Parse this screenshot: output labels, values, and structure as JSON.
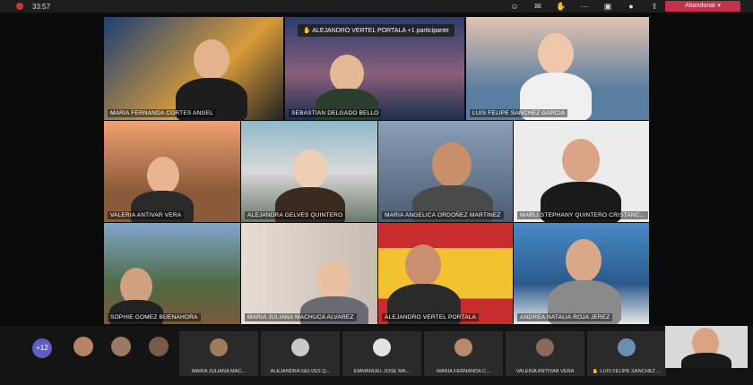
{
  "topbar": {
    "timer": "33:57",
    "leave_label": "Abandonar",
    "icons": [
      "participants-icon",
      "chat-icon",
      "raise-hand-icon",
      "more-icon",
      "camera-icon",
      "microphone-icon",
      "share-icon"
    ]
  },
  "spotlight_tag": "✋ ALEJANDRO VERTEL PORTALA +1 participante",
  "tiles": [
    {
      "name": "MARIA FERNANDA CORTES ANGEL",
      "bg": "#2a3d55"
    },
    {
      "name": "SEBASTIAN DELGADO BELLO",
      "bg": "#3b4a74"
    },
    {
      "name": "LUIS FELIPE SANCHEZ GARCIA",
      "bg": "#5a7ea0"
    },
    {
      "name": "VALERIA ANTIVAR VERA",
      "bg": "#c98a5e"
    },
    {
      "name": "ALEJANDRA GELVES QUINTERO",
      "bg": "#6b8f8a"
    },
    {
      "name": "MARIA ANGELICA ORDOÑEZ MARTINEZ",
      "bg": "#5b6d84"
    },
    {
      "name": "MARLI STEPHANY QUINTERO CRISTANC...",
      "bg": "#e9e9ea"
    },
    {
      "name": "SOPHIE GOMEZ BUENAHORA",
      "bg": "#6d8aa0"
    },
    {
      "name": "MARIA JULIANA MACHUCA ALVAREZ",
      "bg": "#d8cfc8"
    },
    {
      "name": "ALEJANDRO VERTEL PORTALA",
      "bg": "#c62d2d"
    },
    {
      "name": "ANDREA NATALIA ROJA JEREZ",
      "bg": "#3a78b5"
    }
  ],
  "strip": {
    "raised_count": "+12",
    "thumbs": [
      {
        "name": "MARIA JULIANA MAC...",
        "color": "#a07c5a"
      },
      {
        "name": "ALEJANDRA GELVES Q...",
        "color": "#c9c9c9"
      },
      {
        "name": "EMMANUEL JOSE MA...",
        "color": "#e2e2e2"
      },
      {
        "name": "MARIA FERNANDA C...",
        "color": "#b98a6a"
      },
      {
        "name": "VALERIA ANTIVAR VERA",
        "color": "#8a6a5a"
      },
      {
        "name": "✋ LUIS FELIPE SANCHEZ ...",
        "color": "#6a8fb0"
      }
    ]
  }
}
